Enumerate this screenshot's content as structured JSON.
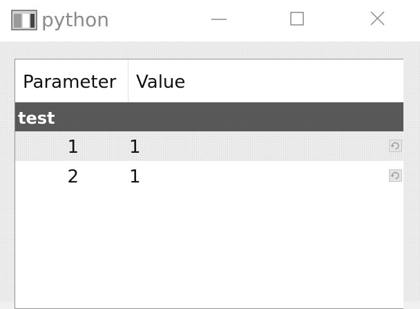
{
  "window": {
    "title": "python",
    "app_icon": "python-app-icon",
    "controls": {
      "minimize_icon": "minimize-icon",
      "maximize_icon": "maximize-icon",
      "close_icon": "close-icon"
    }
  },
  "tree": {
    "columns": [
      "Parameter",
      "Value"
    ],
    "groups": [
      {
        "label": "test",
        "items": [
          {
            "parameter": "1",
            "value": "1",
            "action_icon": "reset-icon"
          },
          {
            "parameter": "2",
            "value": "1",
            "action_icon": "reset-icon"
          }
        ]
      }
    ]
  },
  "colors": {
    "group_header_bg": "#585858",
    "group_header_text": "#ffffff",
    "title_text": "#8a8a8a"
  }
}
